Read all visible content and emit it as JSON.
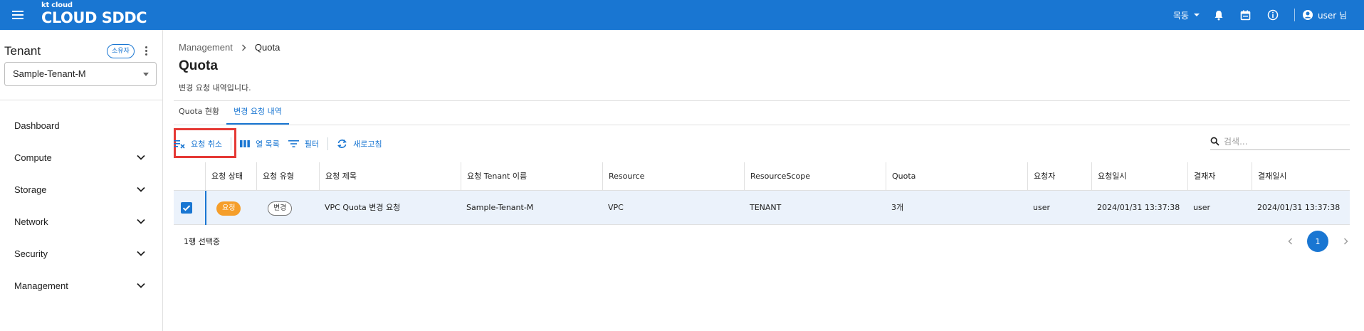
{
  "topbar": {
    "brand_small": "kt cloud",
    "brand_main": "CLOUD SDDC",
    "region": "목동",
    "user": "user 님",
    "icons": [
      "menu-icon",
      "bell-icon",
      "calendar-icon",
      "info-icon",
      "account-icon"
    ]
  },
  "sidebar": {
    "title": "Tenant",
    "badge": "소유자",
    "tenant_selected": "Sample-Tenant-M",
    "items": [
      {
        "label": "Dashboard"
      },
      {
        "label": "Compute"
      },
      {
        "label": "Storage"
      },
      {
        "label": "Network"
      },
      {
        "label": "Security"
      },
      {
        "label": "Management"
      }
    ]
  },
  "breadcrumb": {
    "parent": "Management",
    "current": "Quota"
  },
  "page": {
    "title": "Quota",
    "subtitle": "변경 요청 내역입니다."
  },
  "tabs": [
    {
      "label": "Quota 현황"
    },
    {
      "label": "변경 요청 내역"
    }
  ],
  "toolbar": {
    "cancel": "요청 취소",
    "columns": "열 목록",
    "filter": "필터",
    "refresh": "새로고침",
    "search_placeholder": "검색..."
  },
  "table": {
    "headers": [
      "요청 상태",
      "요청 유형",
      "요청 제목",
      "요청 Tenant 이름",
      "Resource",
      "ResourceScope",
      "Quota",
      "요청자",
      "요청일시",
      "결재자",
      "결재일시"
    ],
    "rows": [
      {
        "status": "요청",
        "type": "변경",
        "title": "VPC Quota 변경 요청",
        "tenant": "Sample-Tenant-M",
        "resource": "VPC",
        "scope": "TENANT",
        "quota": "3개",
        "requester": "user",
        "requested_at": "2024/01/31 13:37:38",
        "approver": "user",
        "approved_at": "2024/01/31 13:37:38"
      }
    ]
  },
  "footer": {
    "selected": "1행 선택중",
    "page": "1"
  },
  "colors": {
    "primary": "#1976d2",
    "status_pending": "#f59e2a",
    "highlight": "#e53935",
    "row_selected": "#ebf2fb"
  }
}
